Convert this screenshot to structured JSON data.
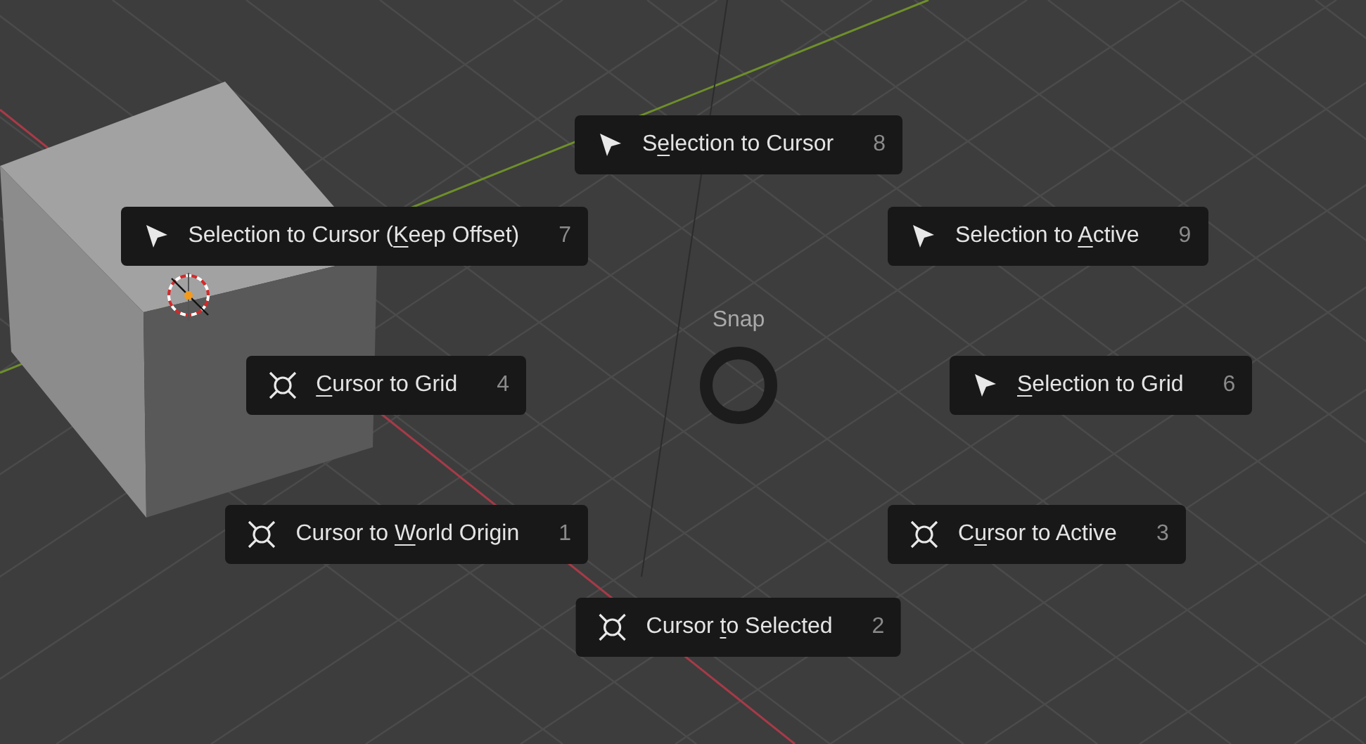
{
  "pie_menu": {
    "title": "Snap",
    "items": [
      {
        "kind": "selection",
        "label_parts": [
          {
            "text": "S",
            "underlined": false
          },
          {
            "text": "e",
            "underlined": true
          },
          {
            "text": "lection to Cursor",
            "underlined": false
          }
        ],
        "shortcut": "8"
      },
      {
        "kind": "selection",
        "label_parts": [
          {
            "text": "Selection to Cursor (",
            "underlined": false
          },
          {
            "text": "K",
            "underlined": true
          },
          {
            "text": "eep Offset)",
            "underlined": false
          }
        ],
        "shortcut": "7"
      },
      {
        "kind": "selection",
        "label_parts": [
          {
            "text": "Selection to ",
            "underlined": false
          },
          {
            "text": "A",
            "underlined": true
          },
          {
            "text": "ctive",
            "underlined": false
          }
        ],
        "shortcut": "9"
      },
      {
        "kind": "cursor",
        "label_parts": [
          {
            "text": "C",
            "underlined": true
          },
          {
            "text": "ursor to Grid",
            "underlined": false
          }
        ],
        "shortcut": "4"
      },
      {
        "kind": "selection",
        "label_parts": [
          {
            "text": "S",
            "underlined": true
          },
          {
            "text": "election to Grid",
            "underlined": false
          }
        ],
        "shortcut": "6"
      },
      {
        "kind": "cursor",
        "label_parts": [
          {
            "text": "Cursor to ",
            "underlined": false
          },
          {
            "text": "W",
            "underlined": true
          },
          {
            "text": "orld Origin",
            "underlined": false
          }
        ],
        "shortcut": "1"
      },
      {
        "kind": "cursor",
        "label_parts": [
          {
            "text": "C",
            "underlined": false
          },
          {
            "text": "u",
            "underlined": true
          },
          {
            "text": "rsor to Active",
            "underlined": false
          }
        ],
        "shortcut": "3"
      },
      {
        "kind": "cursor",
        "label_parts": [
          {
            "text": "Cursor ",
            "underlined": false
          },
          {
            "text": "t",
            "underlined": true
          },
          {
            "text": "o Selected",
            "underlined": false
          }
        ],
        "shortcut": "2"
      }
    ]
  }
}
